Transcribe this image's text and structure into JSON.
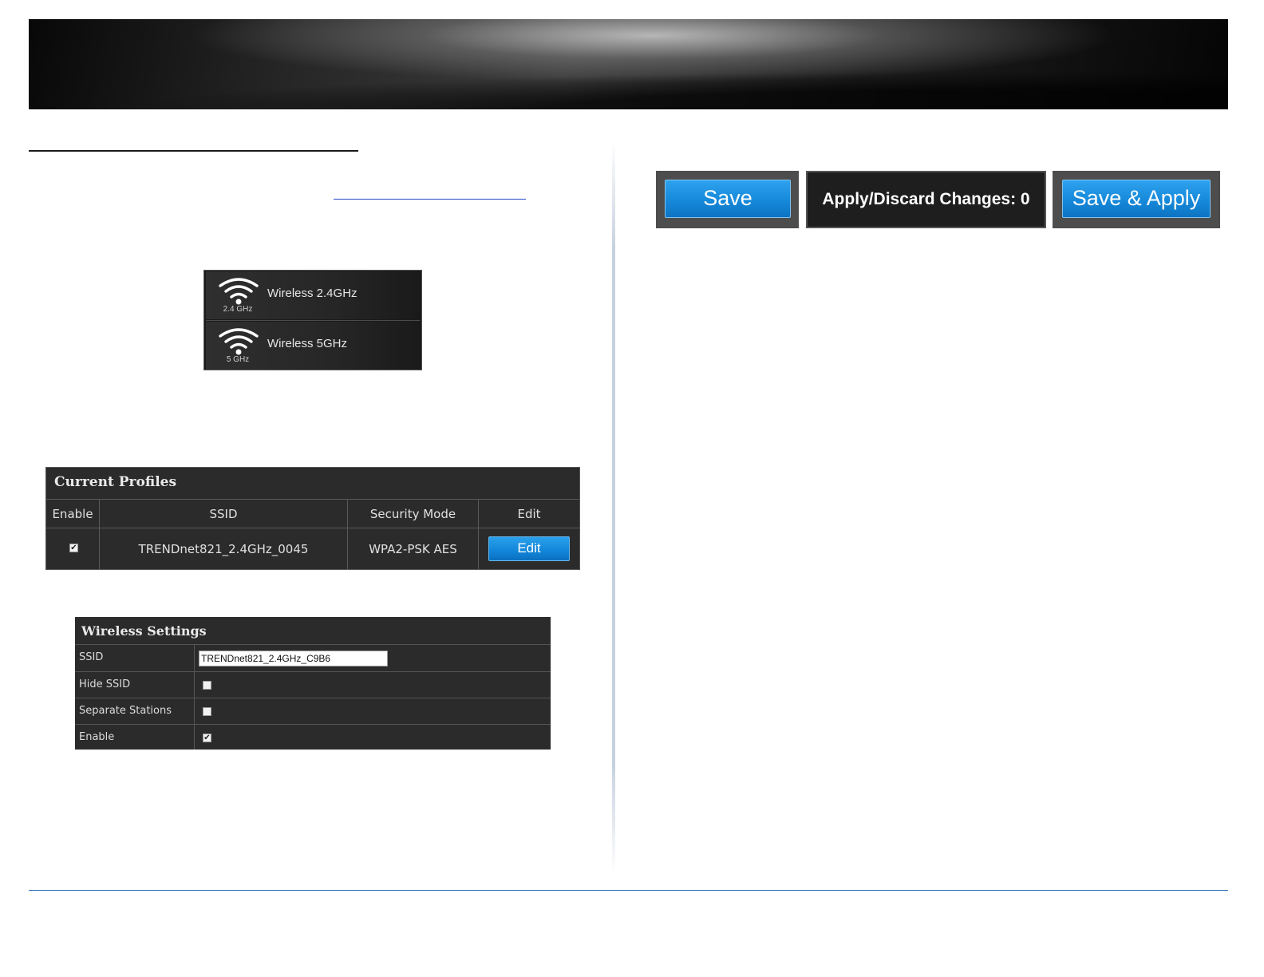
{
  "wireless_menu": {
    "items": [
      {
        "label": "Wireless 2.4GHz",
        "band": "2.4 GHz",
        "icon": "wifi-icon"
      },
      {
        "label": "Wireless 5GHz",
        "band": "5 GHz",
        "icon": "wifi-icon"
      }
    ]
  },
  "toolbar": {
    "save_label": "Save",
    "apply_discard_label": "Apply/Discard Changes: 0",
    "save_apply_label": "Save & Apply"
  },
  "current_profiles": {
    "title": "Current Profiles",
    "columns": [
      "Enable",
      "SSID",
      "Security Mode",
      "Edit"
    ],
    "rows": [
      {
        "enabled": true,
        "check_mark": "✔",
        "ssid": "TRENDnet821_2.4GHz_0045",
        "security_mode": "WPA2-PSK AES",
        "edit_label": "Edit"
      }
    ]
  },
  "wireless_settings": {
    "title": "Wireless Settings",
    "ssid_label": "SSID",
    "ssid_value": "TRENDnet821_2.4GHz_C9B6",
    "hide_ssid_label": "Hide SSID",
    "hide_ssid_checked": false,
    "separate_stations_label": "Separate Stations",
    "separate_stations_checked": false,
    "enable_label": "Enable",
    "enable_checked": true,
    "enable_mark": "✔"
  },
  "colors": {
    "button_blue": "#1689da",
    "panel_dark": "#2b2b2b",
    "footer_rule": "#3a7bbd"
  }
}
